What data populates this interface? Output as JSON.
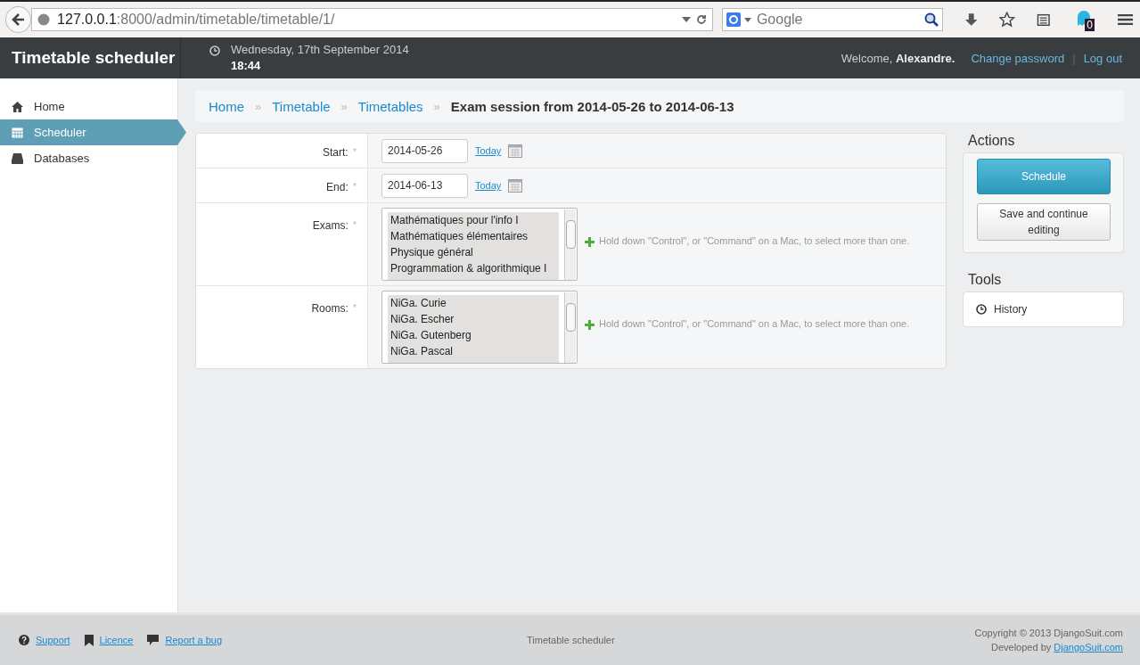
{
  "browser": {
    "url_host": "127.0.0.1",
    "url_path": ":8000/admin/timetable/timetable/1/",
    "search_placeholder": "Google",
    "badge": "0"
  },
  "header": {
    "brand": "Timetable scheduler",
    "date": "Wednesday, 17th September 2014",
    "time": "18:44",
    "welcome": "Welcome,",
    "user": "Alexandre.",
    "links": [
      "Change password",
      "Log out"
    ],
    "separator": "|"
  },
  "sidebar": {
    "items": [
      {
        "label": "Home",
        "kind": "home",
        "selected": false
      },
      {
        "label": "Scheduler",
        "kind": "calendar",
        "selected": true
      },
      {
        "label": "Databases",
        "kind": "database",
        "selected": false
      }
    ]
  },
  "breadcrumbs": {
    "links": [
      {
        "label": "Home",
        "separator": "»"
      },
      {
        "label": "Timetable",
        "separator": "»"
      },
      {
        "label": "Timetables",
        "separator": "»"
      }
    ],
    "current": "Exam session from 2014-05-26 to 2014-06-13"
  },
  "form": {
    "rows": [
      {
        "kind": "date",
        "label": "Start:",
        "required_mark": "*",
        "value": "2014-05-26",
        "today": "Today"
      },
      {
        "kind": "date",
        "label": "End:",
        "required_mark": "*",
        "value": "2014-06-13",
        "today": "Today"
      },
      {
        "kind": "multi",
        "label": "Exams:",
        "required_mark": "*",
        "options": [
          {
            "label": "Mathématiques pour l'info I",
            "selected": true
          },
          {
            "label": "Mathématiques élémentaires",
            "selected": true
          },
          {
            "label": "Physique général",
            "selected": true
          },
          {
            "label": "Programmation & algorithmique I",
            "selected": true
          }
        ],
        "help": "Hold down \"Control\", or \"Command\" on a Mac, to select more than one."
      },
      {
        "kind": "multi",
        "label": "Rooms:",
        "required_mark": "*",
        "options": [
          {
            "label": "NiGa. Curie",
            "selected": true
          },
          {
            "label": "NiGa. Escher",
            "selected": true
          },
          {
            "label": "NiGa. Gutenberg",
            "selected": true
          },
          {
            "label": "NiGa. Pascal",
            "selected": true
          }
        ],
        "help": "Hold down \"Control\", or \"Command\" on a Mac, to select more than one."
      }
    ]
  },
  "actions": {
    "title": "Actions",
    "buttons": [
      {
        "label": "Schedule",
        "kind": "primary"
      },
      {
        "label": "Save and continue editing",
        "kind": "default"
      }
    ]
  },
  "tools": {
    "title": "Tools",
    "items": [
      "History"
    ]
  },
  "footer": {
    "links": [
      {
        "label": "Support",
        "kind": "question"
      },
      {
        "label": "Licence",
        "kind": "bookmark"
      },
      {
        "label": "Report a bug",
        "kind": "comment"
      }
    ],
    "center": "Timetable scheduler",
    "copyright": "Copyright © 2013 DjangoSuit.com",
    "developed": "Developed by",
    "developed_link": "DjangoSuit.com"
  }
}
